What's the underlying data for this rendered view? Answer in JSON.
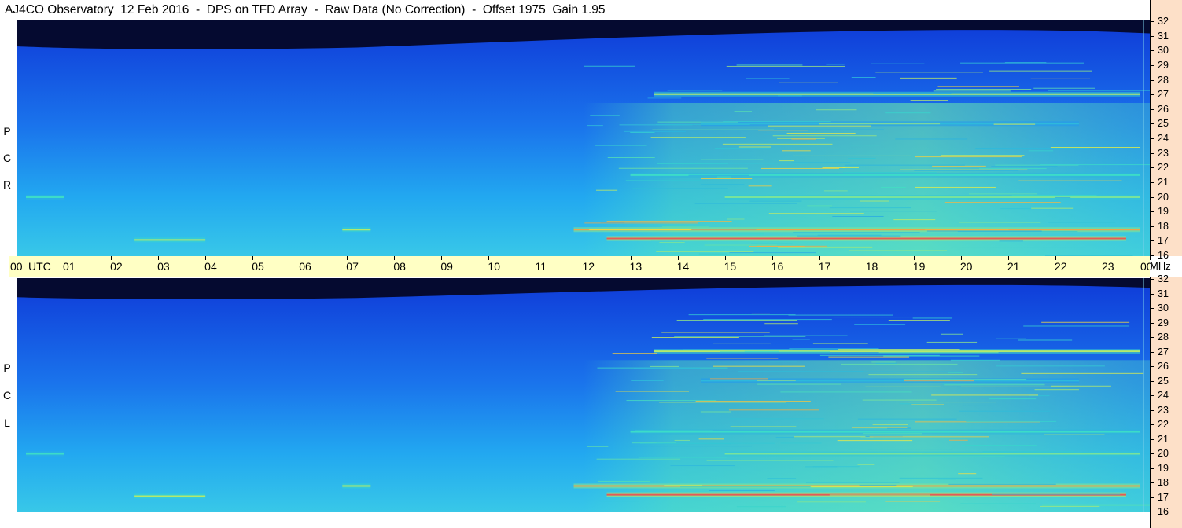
{
  "title": "AJ4CO Observatory  12 Feb 2016  -  DPS on TFD Array  -  Raw Data (No Correction)  -  Offset 1975  Gain 1.95",
  "colors": {
    "band_bg": "#ffffc4",
    "axis_bg": "#fde0c8",
    "night": "#050a30",
    "low": "#1040e0",
    "mid": "#20a0f0",
    "high": "#f0f040",
    "peak": "#e01060"
  },
  "panels": [
    {
      "id": "rcp",
      "letters": [
        "R",
        "C",
        "P"
      ]
    },
    {
      "id": "lcp",
      "letters": [
        "L",
        "C",
        "P"
      ]
    }
  ],
  "chart_data": {
    "type": "heatmap",
    "x": {
      "unit": "UTC",
      "range": [
        0,
        24
      ],
      "ticks": [
        "00",
        "01",
        "02",
        "03",
        "04",
        "05",
        "06",
        "07",
        "08",
        "09",
        "10",
        "11",
        "12",
        "13",
        "14",
        "15",
        "16",
        "17",
        "18",
        "19",
        "20",
        "21",
        "22",
        "23",
        "00"
      ]
    },
    "y": {
      "unit": "MHz",
      "range": [
        16,
        32
      ],
      "ticks": [
        32,
        31,
        30,
        29,
        28,
        27,
        26,
        25,
        24,
        23,
        22,
        21,
        20,
        19,
        18,
        17,
        16
      ]
    },
    "x_label": "UTC",
    "y_label": "MHz",
    "series": [
      {
        "name": "RCP",
        "rows": "frequency 16-32 MHz",
        "note_hidden": true
      },
      {
        "name": "LCP",
        "rows": "frequency 16-32 MHz",
        "note_hidden": true
      }
    ],
    "features": [
      {
        "band_mhz": 27.0,
        "t_start": 13.5,
        "t_end": 23.8,
        "intensity": 0.8
      },
      {
        "band_mhz": 25.0,
        "t_start": 14.5,
        "t_end": 22.5,
        "intensity": 0.6
      },
      {
        "band_mhz": 21.5,
        "t_start": 13.0,
        "t_end": 23.8,
        "intensity": 0.7
      },
      {
        "band_mhz": 20.0,
        "t_start": 15.0,
        "t_end": 23.8,
        "intensity": 0.75
      },
      {
        "band_mhz": 17.8,
        "t_start": 11.8,
        "t_end": 23.8,
        "intensity": 0.9
      },
      {
        "band_mhz": 17.2,
        "t_start": 12.5,
        "t_end": 23.5,
        "intensity": 0.95
      },
      {
        "band_mhz": 17.1,
        "t_start": 2.5,
        "t_end": 4.0,
        "intensity": 0.8
      },
      {
        "band_mhz": 17.8,
        "t_start": 6.9,
        "t_end": 7.5,
        "intensity": 0.8
      },
      {
        "band_mhz": 20.0,
        "t_start": 0.2,
        "t_end": 1.0,
        "intensity": 0.7
      }
    ]
  }
}
